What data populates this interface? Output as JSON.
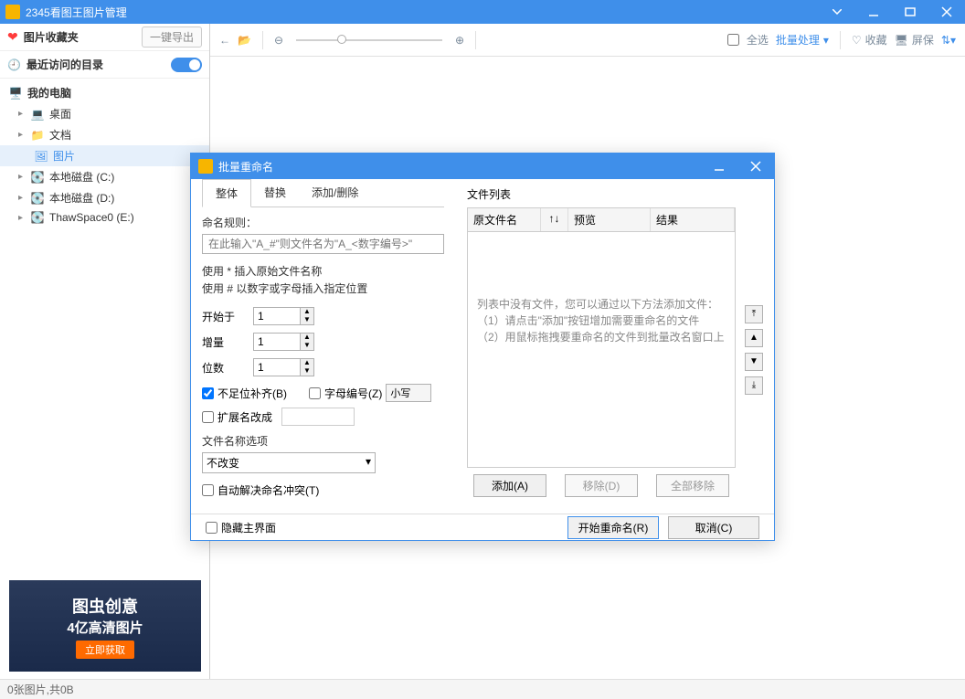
{
  "app": {
    "title": "2345看图王图片管理"
  },
  "favorites": {
    "label": "图片收藏夹",
    "export": "一键导出"
  },
  "recent": {
    "label": "最近访问的目录"
  },
  "tree": {
    "root": "我的电脑",
    "items": [
      {
        "label": "桌面",
        "icon": "💻"
      },
      {
        "label": "文档",
        "icon": "📁"
      },
      {
        "label": "图片",
        "icon": "🖼"
      },
      {
        "label": "本地磁盘 (C:)",
        "icon": "💽"
      },
      {
        "label": "本地磁盘 (D:)",
        "icon": "💽"
      },
      {
        "label": "ThawSpace0 (E:)",
        "icon": "💽"
      }
    ]
  },
  "toolbar": {
    "selectall": "全选",
    "batch": "批量处理",
    "collect": "收藏",
    "screensaver": "屏保"
  },
  "ad": {
    "line1": "图虫创意",
    "line2": "4亿高清图片",
    "btn": "立即获取"
  },
  "status": {
    "text": "0张图片,共0B"
  },
  "dialog": {
    "title": "批量重命名",
    "tabs": {
      "whole": "整体",
      "replace": "替换",
      "adddel": "添加/删除"
    },
    "rule_label": "命名规则：",
    "rule_placeholder": "在此输入\"A_#\"则文件名为\"A_<数字编号>\"",
    "hint1": "使用 * 插入原始文件名称",
    "hint2": "使用 # 以数字或字母插入指定位置",
    "start": "开始于",
    "start_v": "1",
    "inc": "增量",
    "inc_v": "1",
    "digits": "位数",
    "digits_v": "1",
    "pad": "不足位补齐(B)",
    "letter": "字母编号(Z)",
    "letter_sel": "小写",
    "ext": "扩展名改成",
    "nameopt": "文件名称选项",
    "nameopt_v": "不改变",
    "autoconflict": "自动解决命名冲突(T)",
    "filelist": "文件列表",
    "col1": "原文件名",
    "col2": "↑↓",
    "col3": "预览",
    "col4": "结果",
    "empty1": "列表中没有文件，您可以通过以下方法添加文件：",
    "empty2": "（1）请点击\"添加\"按钮增加需要重命名的文件",
    "empty3": "（2）用鼠标拖拽要重命名的文件到批量改名窗口上",
    "add": "添加(A)",
    "remove": "移除(D)",
    "removeall": "全部移除",
    "hidemain": "隐藏主界面",
    "start_btn": "开始重命名(R)",
    "cancel": "取消(C)"
  }
}
